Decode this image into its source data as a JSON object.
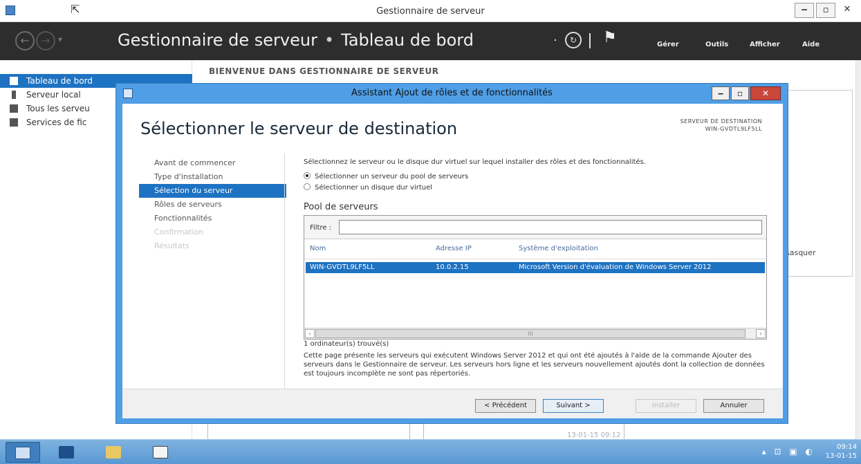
{
  "window": {
    "title": "Gestionnaire de serveur"
  },
  "header": {
    "app_name": "Gestionnaire de serveur",
    "separator": "•",
    "page": "Tableau de bord",
    "menus": [
      "Gérer",
      "Outils",
      "Afficher",
      "Aide"
    ]
  },
  "leftnav": {
    "items": [
      {
        "label": "Tableau de bord",
        "icon": "dashboard-icon",
        "active": true
      },
      {
        "label": "Serveur local",
        "icon": "server-icon",
        "active": false
      },
      {
        "label": "Tous les serveu",
        "icon": "servers-icon",
        "active": false
      },
      {
        "label": "Services de fic",
        "icon": "file-services-icon",
        "active": false
      }
    ]
  },
  "main": {
    "welcome": "BIENVENUE DANS GESTIONNAIRE DE SERVEUR",
    "side_text": "sasquer",
    "tile_date": "13-01-15 09:12"
  },
  "dialog": {
    "title": "Assistant Ajout de rôles et de fonctionnalités",
    "heading": "Sélectionner le serveur de destination",
    "dest_label": "SERVEUR DE DESTINATION",
    "dest_server": "WIN-GVDTL9LF5LL",
    "steps": [
      {
        "label": "Avant de commencer",
        "state": "normal"
      },
      {
        "label": "Type d'installation",
        "state": "normal"
      },
      {
        "label": "Sélection du serveur",
        "state": "active"
      },
      {
        "label": "Rôles de serveurs",
        "state": "normal"
      },
      {
        "label": "Fonctionnalités",
        "state": "normal"
      },
      {
        "label": "Confirmation",
        "state": "disabled"
      },
      {
        "label": "Résultats",
        "state": "disabled"
      }
    ],
    "intro": "Sélectionnez le serveur ou le disque dur virtuel sur lequel installer des rôles et des fonctionnalités.",
    "options": [
      {
        "label": "Sélectionner un serveur du pool de serveurs",
        "checked": true
      },
      {
        "label": "Sélectionner un disque dur virtuel",
        "checked": false
      }
    ],
    "pool_title": "Pool de serveurs",
    "filter_label": "Filtre :",
    "filter_value": "",
    "columns": [
      "Nom",
      "Adresse IP",
      "Système d'exploitation"
    ],
    "rows": [
      {
        "name": "WIN-GVDTL9LF5LL",
        "ip": "10.0.2.15",
        "os": "Microsoft Version d'évaluation de Windows Server 2012"
      }
    ],
    "found": "1 ordinateur(s) trouvé(s)",
    "description": "Cette page présente les serveurs qui exécutent Windows Server 2012 et qui ont été ajoutés à l'aide de la commande Ajouter des serveurs dans le Gestionnaire de serveur. Les serveurs hors ligne et les serveurs nouvellement ajoutés dont la collection de données est toujours incomplète ne sont pas répertoriés.",
    "buttons": {
      "previous": "< Précédent",
      "next": "Suivant >",
      "install": "Installer",
      "cancel": "Annuler"
    }
  },
  "taskbar": {
    "time": "09:14",
    "date": "13-01-15"
  }
}
